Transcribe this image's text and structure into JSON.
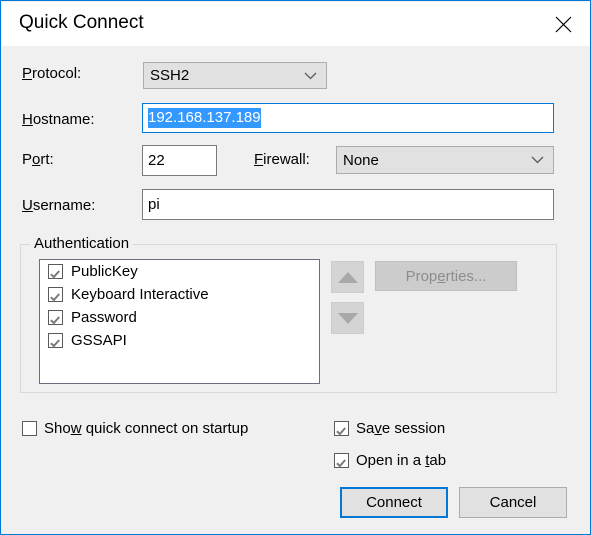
{
  "window": {
    "title": "Quick Connect",
    "close_icon": "close-icon",
    "accent_color": "#0078d7",
    "background_color": "#f0f0f0",
    "selection_color": "#3399ff"
  },
  "form": {
    "protocol": {
      "label": "Protocol:",
      "label_accel": "P",
      "value": "SSH2",
      "options": [
        "SSH2"
      ],
      "arrow_icon": "chevron-down-icon"
    },
    "hostname": {
      "label": "Hostname:",
      "label_accel": "H",
      "value": "192.168.137.189",
      "selected": true
    },
    "port": {
      "label": "Port:",
      "label_accel": "o",
      "value": "22"
    },
    "firewall": {
      "label": "Firewall:",
      "label_accel": "F",
      "value": "None",
      "options": [
        "None"
      ],
      "arrow_icon": "chevron-down-icon"
    },
    "username": {
      "label": "Username:",
      "label_accel": "U",
      "value": "pi"
    }
  },
  "authentication": {
    "legend": "Authentication",
    "items": [
      {
        "label": "PublicKey",
        "checked": true
      },
      {
        "label": "Keyboard Interactive",
        "checked": true
      },
      {
        "label": "Password",
        "checked": true
      },
      {
        "label": "GSSAPI",
        "checked": true
      }
    ],
    "move_up_icon": "triangle-up-icon",
    "move_down_icon": "triangle-down-icon",
    "properties_button": {
      "label_before": "Prop",
      "label_accel": "e",
      "label_after": "rties...",
      "enabled": false
    }
  },
  "options": {
    "show_on_startup": {
      "label_before": "Sho",
      "label_accel": "w",
      "label_after": " quick connect on startup",
      "checked": false
    },
    "save_session": {
      "label_before": "Sa",
      "label_accel": "v",
      "label_after": "e session",
      "checked": true
    },
    "open_in_tab": {
      "label_before": "Open in a ",
      "label_accel": "t",
      "label_after": "ab",
      "checked": true
    }
  },
  "buttons": {
    "connect": {
      "label": "Connect",
      "is_default": true
    },
    "cancel": {
      "label": "Cancel",
      "is_default": false
    }
  }
}
